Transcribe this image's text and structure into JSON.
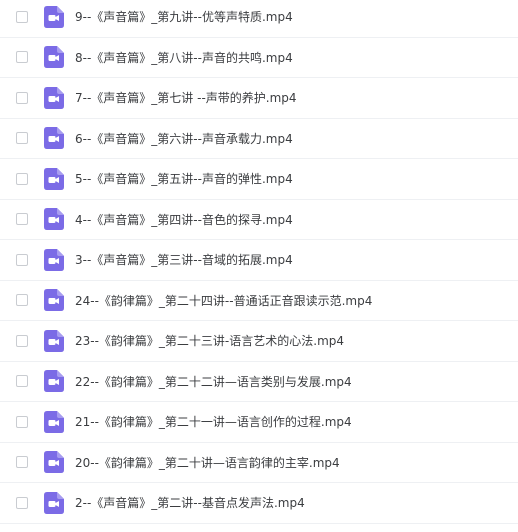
{
  "accent_color": "#7b6be6",
  "file_icon": "video-file-icon",
  "files": [
    {
      "name": "9--《声音篇》_第九讲--优等声特质.mp4"
    },
    {
      "name": "8--《声音篇》_第八讲--声音的共鸣.mp4"
    },
    {
      "name": "7--《声音篇》_第七讲 --声带的养护.mp4"
    },
    {
      "name": "6--《声音篇》_第六讲--声音承载力.mp4"
    },
    {
      "name": "5--《声音篇》_第五讲--声音的弹性.mp4"
    },
    {
      "name": "4--《声音篇》_第四讲--音色的探寻.mp4"
    },
    {
      "name": "3--《声音篇》_第三讲--音域的拓展.mp4"
    },
    {
      "name": "24--《韵律篇》_第二十四讲--普通话正音跟读示范.mp4"
    },
    {
      "name": "23--《韵律篇》_第二十三讲-语言艺术的心法.mp4"
    },
    {
      "name": "22--《韵律篇》_第二十二讲—语言类别与发展.mp4"
    },
    {
      "name": "21--《韵律篇》_第二十一讲—语言创作的过程.mp4"
    },
    {
      "name": "20--《韵律篇》_第二十讲—语言韵律的主宰.mp4"
    },
    {
      "name": "2--《声音篇》_第二讲--基音点发声法.mp4"
    }
  ]
}
